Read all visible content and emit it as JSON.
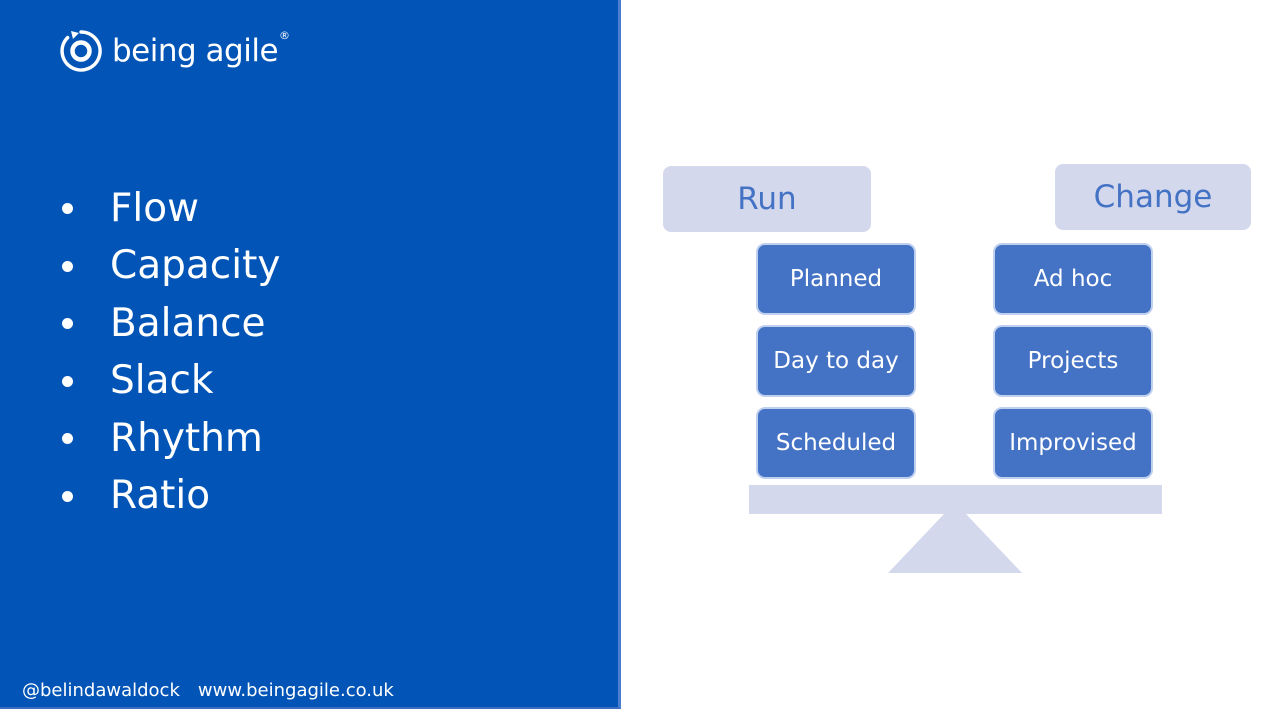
{
  "brand": {
    "logo_icon": "circular-arrow-ring-icon",
    "name": "being agile",
    "registered_mark": "®",
    "panel_color": "#0254b7"
  },
  "bullets": [
    "Flow",
    "Capacity",
    "Balance",
    "Slack",
    "Rhythm",
    "Ratio"
  ],
  "footer": {
    "handle": "@belindawaldock",
    "website": "www.beingagile.co.uk"
  },
  "diagram": {
    "left_header": "Run",
    "right_header": "Change",
    "left_items": [
      "Planned",
      "Day to day",
      "Scheduled"
    ],
    "right_items": [
      "Ad hoc",
      "Projects",
      "Improvised"
    ],
    "colors": {
      "item_fill": "#4472c4",
      "header_fill": "#d4d8ec",
      "header_text": "#4472c4"
    }
  }
}
